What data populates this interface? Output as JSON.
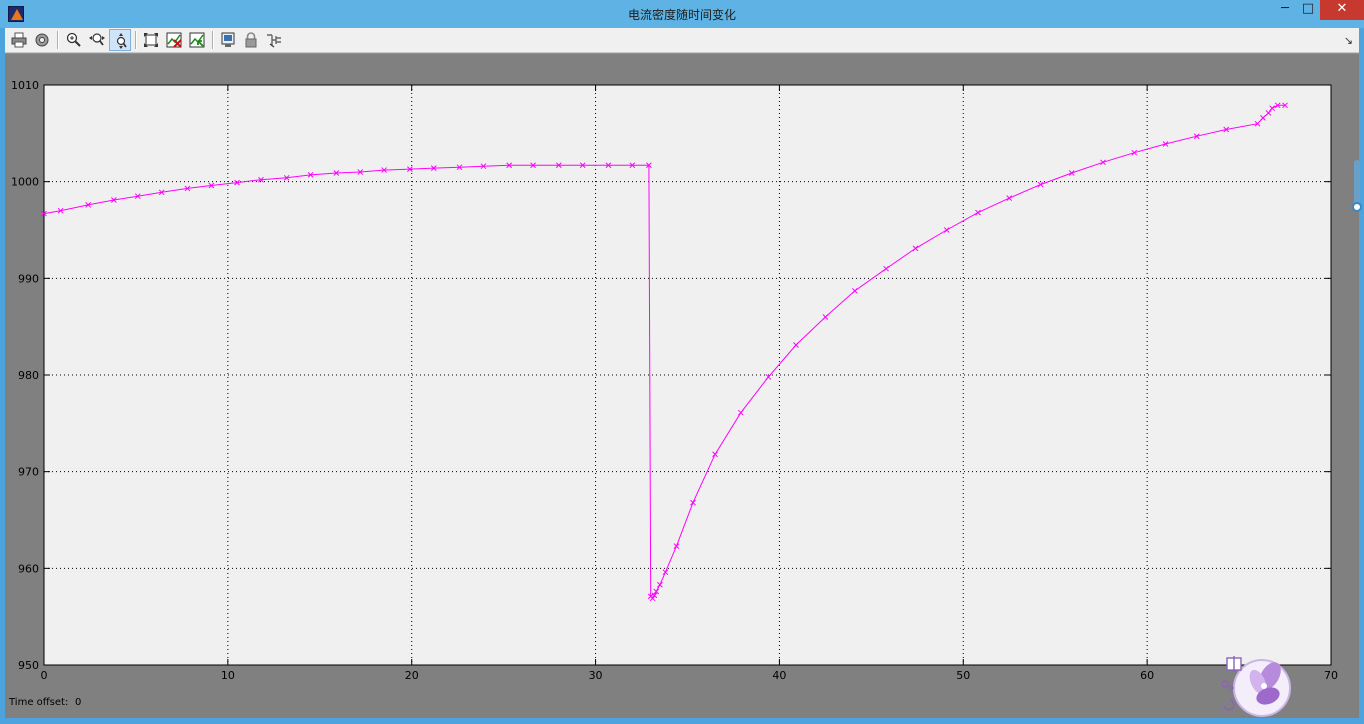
{
  "window": {
    "title": "电流密度随时间变化",
    "minimize_glyph": "─",
    "maximize_glyph": "□",
    "close_glyph": "✕"
  },
  "toolbar": {
    "buttons": [
      {
        "icon": "print-icon"
      },
      {
        "icon": "parameters-gear-icon"
      },
      {
        "icon": "zoom-in-icon"
      },
      {
        "icon": "zoom-x-icon"
      },
      {
        "icon": "zoom-y-icon",
        "active": true
      },
      {
        "icon": "autoscale-icon"
      },
      {
        "icon": "save-axes-settings-icon"
      },
      {
        "icon": "restore-axes-settings-icon"
      },
      {
        "icon": "floating-scope-icon"
      },
      {
        "icon": "lock-axes-icon"
      },
      {
        "icon": "signal-selection-icon"
      }
    ],
    "dock_glyph": "↘"
  },
  "footer": {
    "time_offset_label": "Time offset:",
    "time_offset_value": "0"
  },
  "colors": {
    "series": "#ff00ff",
    "plot_bg": "#f0f0f0",
    "frame_bg": "#808080"
  },
  "chart_data": {
    "type": "line",
    "title": "",
    "xlabel": "",
    "ylabel": "",
    "xlim": [
      0,
      70
    ],
    "ylim": [
      950,
      1010
    ],
    "xticks": [
      0,
      10,
      20,
      30,
      40,
      50,
      60,
      70
    ],
    "yticks": [
      950,
      960,
      970,
      980,
      990,
      1000,
      1010
    ],
    "grid": true,
    "marker": "x",
    "series": [
      {
        "values_x": [
          0,
          0.9,
          2.4,
          3.8,
          5.1,
          6.4,
          7.8,
          9.1,
          10.5,
          11.8,
          13.2,
          14.5,
          15.9,
          17.2,
          18.5,
          19.9,
          21.2,
          22.6,
          23.9,
          25.3,
          26.6,
          28.0,
          29.3,
          30.7,
          32.0,
          32.9,
          33.0,
          33.1,
          33.2,
          33.3,
          33.5,
          33.8,
          34.4,
          35.3,
          36.5,
          37.9,
          39.4,
          40.9,
          42.5,
          44.1,
          45.8,
          47.4,
          49.1,
          50.8,
          52.5,
          54.2,
          55.9,
          57.6,
          59.3,
          61.0,
          62.7,
          64.3,
          66.0,
          66.3,
          66.6,
          66.8,
          67.1,
          67.5
        ],
        "values_y": [
          996.7,
          997.0,
          997.6,
          998.1,
          998.5,
          998.9,
          999.3,
          999.6,
          999.9,
          1000.2,
          1000.4,
          1000.7,
          1000.9,
          1001.0,
          1001.2,
          1001.3,
          1001.4,
          1001.5,
          1001.6,
          1001.7,
          1001.7,
          1001.7,
          1001.7,
          1001.7,
          1001.7,
          1001.7,
          957.1,
          956.9,
          957.2,
          957.6,
          958.3,
          959.6,
          962.3,
          966.8,
          971.8,
          976.1,
          979.8,
          983.1,
          986.0,
          988.7,
          991.0,
          993.1,
          995.0,
          996.8,
          998.3,
          999.7,
          1000.9,
          1002.0,
          1003.0,
          1003.9,
          1004.7,
          1005.4,
          1006.0,
          1006.6,
          1007.1,
          1007.6,
          1007.9,
          1007.9
        ]
      }
    ]
  }
}
